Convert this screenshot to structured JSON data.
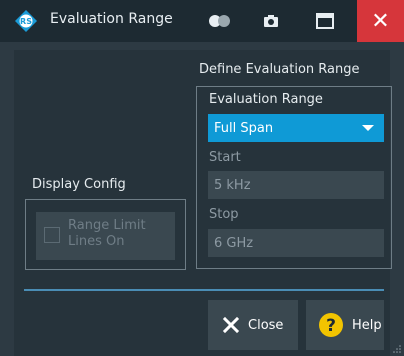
{
  "window": {
    "title": "Evaluation Range",
    "close_glyph": "✕"
  },
  "define_group": {
    "heading": "Define Evaluation Range",
    "range_label": "Evaluation Range",
    "range_value": "Full Span",
    "start_label": "Start",
    "start_value": "5 kHz",
    "stop_label": "Stop",
    "stop_value": "6 GHz"
  },
  "display_group": {
    "heading": "Display Config",
    "checkbox_label_line1": "Range Limit",
    "checkbox_label_line2": "Lines On"
  },
  "buttons": {
    "close_label": "Close",
    "help_label": "Help"
  },
  "colors": {
    "accent": "#0f9ad6",
    "close_red": "#d6363b",
    "help_yellow": "#f2c400"
  }
}
